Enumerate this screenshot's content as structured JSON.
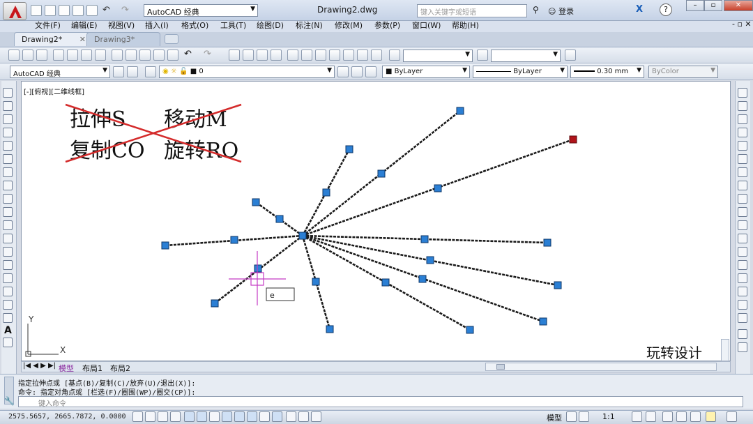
{
  "window": {
    "title": "Drawing2.dwg",
    "workspace": "AutoCAD 经典",
    "search_placeholder": "键入关键字或短语",
    "login": "登录"
  },
  "menu": [
    "文件(F)",
    "编辑(E)",
    "视图(V)",
    "插入(I)",
    "格式(O)",
    "工具(T)",
    "绘图(D)",
    "标注(N)",
    "修改(M)",
    "参数(P)",
    "窗口(W)",
    "帮助(H)"
  ],
  "tabs": [
    "Drawing2*",
    "Drawing3*"
  ],
  "toolbar": {
    "workspace": "AutoCAD 经典",
    "layer": "0",
    "color": "ByLayer",
    "linetype": "ByLayer",
    "lineweight": "0.30 mm",
    "plotstyle": "ByColor"
  },
  "viewport_label": "[-][俯视][二维线框]",
  "annotations": {
    "row1_left": "拉伸S",
    "row1_right": "移动M",
    "row2_left": "复制CO",
    "row2_right": "旋转RO"
  },
  "dynamic_input": "e",
  "watermark": "玩转设计",
  "layout_tabs": [
    "模型",
    "布局1",
    "布局2"
  ],
  "command_history": [
    "指定拉伸点或 [基点(B)/复制(C)/放弃(U)/退出(X)]:",
    "命令: 指定对角点或 [栏选(F)/圈围(WP)/圈交(CP)]:"
  ],
  "command_placeholder": "键入命令",
  "status": {
    "coords": "2575.5657, 2665.7872, 0.0000",
    "model": "模型",
    "scale": "1:1"
  },
  "colors": {
    "grip": "#2b7fd4",
    "grip_selected": "#b0141a",
    "annotation_strike": "#d42a2a",
    "crosshair": "#c43ac4"
  }
}
